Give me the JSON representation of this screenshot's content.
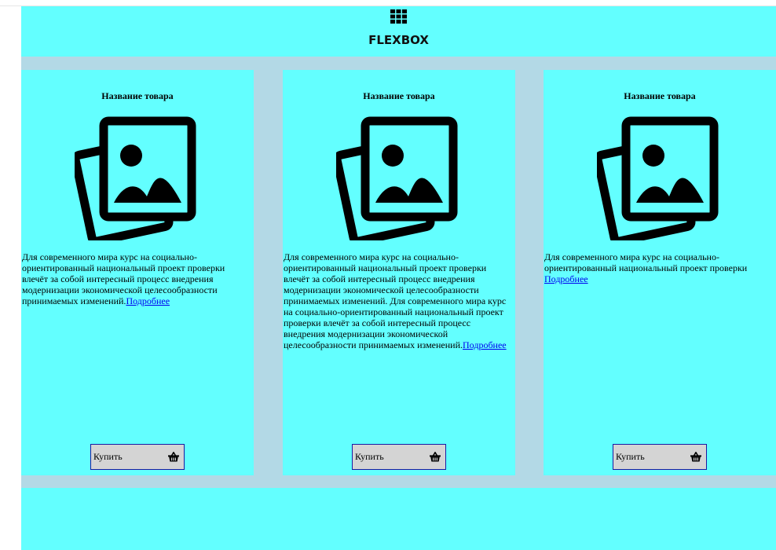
{
  "header": {
    "icon": "grid-icon",
    "title": "FLEXBOX"
  },
  "cards": [
    {
      "title": "Название товара",
      "image_icon": "images-icon",
      "text": "Для современного мира курс на социально-ориентированный национальный проект проверки влечёт за собой интересный процесс внедрения модернизации экономической целесообразности принимаемых изменений.",
      "more_link": "Подробнее",
      "buy_label": "Купить",
      "buy_icon": "basket-icon"
    },
    {
      "title": "Название товара",
      "image_icon": "images-icon",
      "text": "Для современного мира курс на социально-ориентированный национальный проект проверки влечёт за собой интересный процесс внедрения модернизации экономической целесообразности принимаемых изменений. Для современного мира курс на социально-ориентированный национальный проект проверки влечёт за собой интересный процесс внедрения модернизации экономической целесообразности принимаемых изменений.",
      "more_link": "Подробнее",
      "buy_label": "Купить",
      "buy_icon": "basket-icon"
    },
    {
      "title": "Название товара",
      "image_icon": "images-icon",
      "text": "Для современного мира курс на социально-ориентированный национальный проект проверки ",
      "more_link": "Подробнее",
      "buy_label": "Купить",
      "buy_icon": "basket-icon"
    }
  ],
  "colors": {
    "page_background": "#63ffff",
    "band_background": "#b3d9e6",
    "button_background": "#d4d4d4",
    "link": "#0000ee"
  }
}
